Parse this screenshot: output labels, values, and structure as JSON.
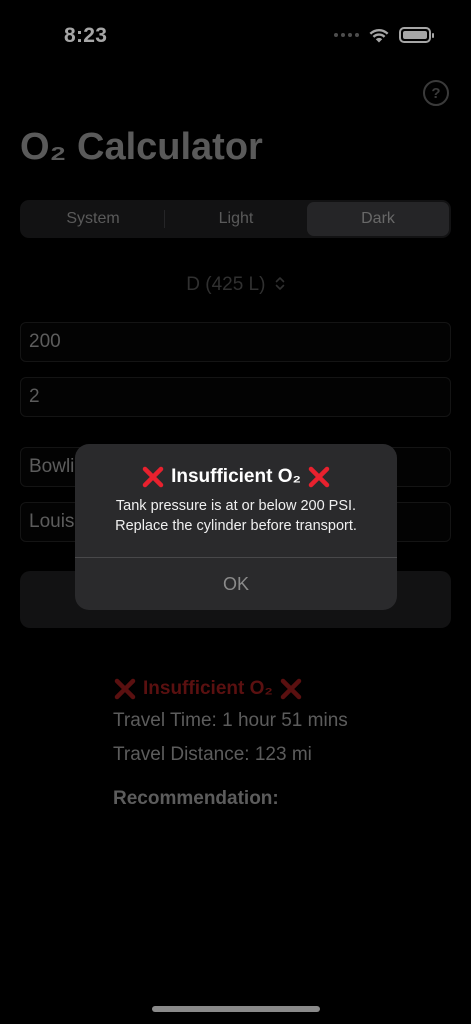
{
  "status_bar": {
    "time": "8:23"
  },
  "header": {
    "help_icon": "question-circle-icon",
    "help_glyph": "?",
    "title": "O₂ Calculator"
  },
  "appearance": {
    "segments": [
      {
        "label": "System",
        "selected": false
      },
      {
        "label": "Light",
        "selected": false
      },
      {
        "label": "Dark",
        "selected": true
      }
    ]
  },
  "tank": {
    "selected": "D (425 L)",
    "picker_icon": "chevron-up-down-icon"
  },
  "inputs": {
    "pressure_value": "200",
    "flow_rate_value": "2",
    "origin_value": "Bowli",
    "destination_value": "Louis"
  },
  "results": {
    "status": "Insufficient O₂",
    "travel_time": "Travel Time: 1 hour 51 mins",
    "travel_distance": "Travel Distance: 123 mi",
    "recommendation_heading": "Recommendation:"
  },
  "alert": {
    "title": "Insufficient O₂",
    "message_line1": "Tank pressure is at or below 200 PSI.",
    "message_line2": "Replace the cylinder before transport.",
    "ok_label": "OK"
  },
  "colors": {
    "error_red": "#e8212e",
    "dim_red": "#8b1a1a",
    "background": "#000000",
    "alert_bg": "#2a2a2c"
  }
}
